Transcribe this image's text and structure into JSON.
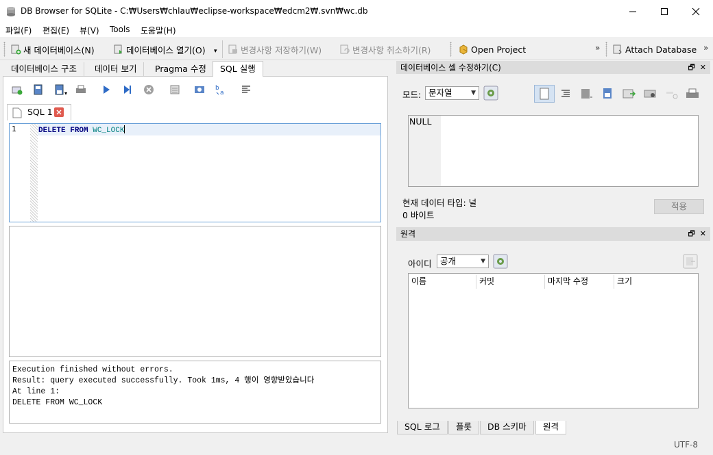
{
  "window": {
    "title": "DB Browser for SQLite - C:₩Users₩chlau₩eclipse-workspace₩edcm2₩.svn₩wc.db"
  },
  "menu": [
    "파일(F)",
    "편집(E)",
    "뷰(V)",
    "Tools",
    "도움말(H)"
  ],
  "toolbar": {
    "new_db": "새 데이터베이스(N)",
    "open_db": "데이터베이스 열기(O)",
    "write_changes": "변경사항 저장하기(W)",
    "revert_changes": "변경사항 취소하기(R)",
    "open_project": "Open Project",
    "attach_db": "Attach Database",
    "overflow": "»"
  },
  "left_tabs": [
    "데이터베이스 구조",
    "데이터 보기",
    "Pragma 수정",
    "SQL 실행"
  ],
  "sql_tab": {
    "label": "SQL 1"
  },
  "editor": {
    "line_number": "1",
    "kw_delete": "DELETE",
    "kw_from": "FROM",
    "table": "WC_LOCK"
  },
  "messages": [
    "Execution finished without errors.",
    "Result: query executed successfully. Took 1ms, 4 행이 영향받았습니다",
    "At line 1:",
    "DELETE FROM WC_LOCK"
  ],
  "edit_cell": {
    "title": "데이터베이스 셀 수정하기(C)",
    "mode_label": "모드:",
    "mode_value": "문자열",
    "cell_value": "NULL",
    "type_label": "현재 데이터 타입: 널",
    "size_label": "0 바이트",
    "apply": "적용"
  },
  "remote": {
    "title": "원격",
    "id_label": "아이디",
    "id_value": "공개",
    "columns": [
      "이름",
      "커밋",
      "마지막 수정",
      "크기"
    ]
  },
  "bottom_tabs": [
    "SQL 로그",
    "플롯",
    "DB 스키마",
    "원격"
  ],
  "status": {
    "encoding": "UTF-8"
  },
  "colors": {
    "accent": "#6aa0d8",
    "keyword": "#00007f",
    "identifier": "#00807f",
    "close_red": "#e05a4f"
  }
}
